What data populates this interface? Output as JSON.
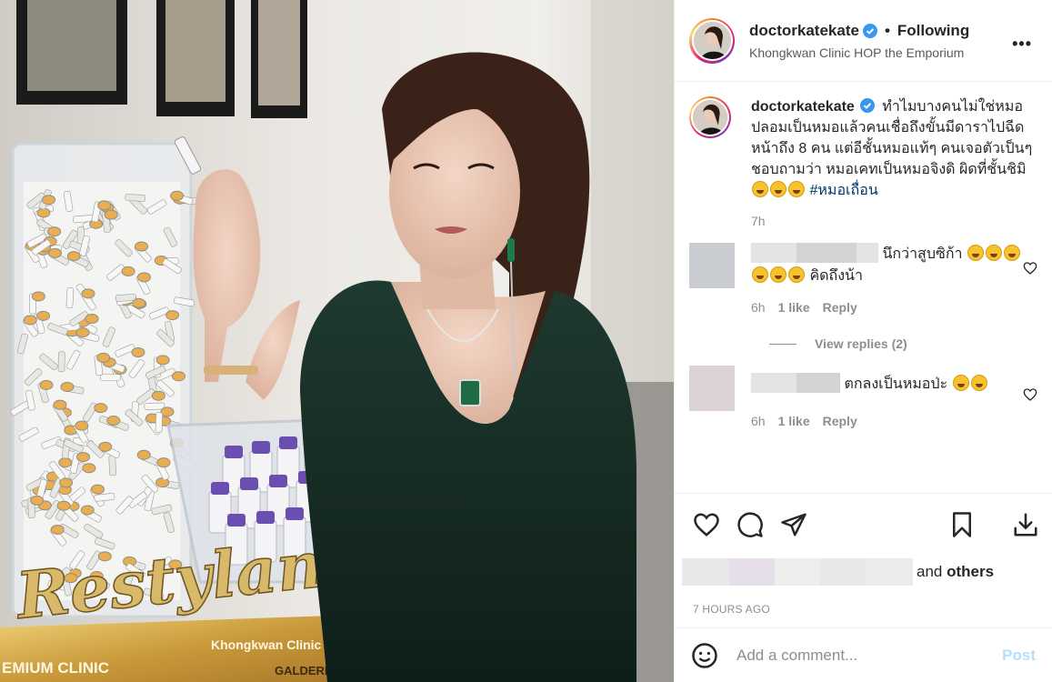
{
  "post": {
    "username": "doctorkatekate",
    "follow_status": "Following",
    "separator": "•",
    "location": "Khongkwan Clinic HOP the Emporium",
    "more_icon": "more-horizontal-icon"
  },
  "photo": {
    "brand_logo": "Restylane",
    "box_text_left": "EMIUM CLINIC",
    "box_text_right": "Khongkwan Clinic",
    "box_brand": "GALDERMA"
  },
  "caption": {
    "username": "doctorkatekate",
    "text": "ทำไมบางคนไม่ใช่หมอ ปลอมเป็นหมอแล้วคนเชื่อถึงขั้นมีดาราไปฉีดหน้าถึง 8 คน แต่อีชั้นหมอแท้ๆ คนเจอตัวเป็นๆชอบถามว่า หมอเคทเป็นหมอจิงดิ ผิดที่ชั้นชิมิ",
    "hashtag": "#หมอเถื่อน",
    "time": "7h"
  },
  "comments": [
    {
      "text": "นึกว่าสูบซิก้า",
      "text_line2": "คิดถึงน้า",
      "time": "6h",
      "likes": "1 like",
      "reply": "Reply"
    },
    {
      "text": "ตกลงเป็นหมอป่ะ",
      "time": "6h",
      "likes": "1 like",
      "reply": "Reply"
    }
  ],
  "view_replies": "View replies (2)",
  "likes": {
    "and": "and",
    "others": "others"
  },
  "time_ago": "7 HOURS AGO",
  "add_comment": {
    "placeholder": "Add a comment...",
    "post": "Post"
  },
  "colors": {
    "accent_link": "#00376b",
    "muted": "#8e8e8e",
    "post_disabled": "#b2dffc",
    "verified": "#3897f0"
  }
}
